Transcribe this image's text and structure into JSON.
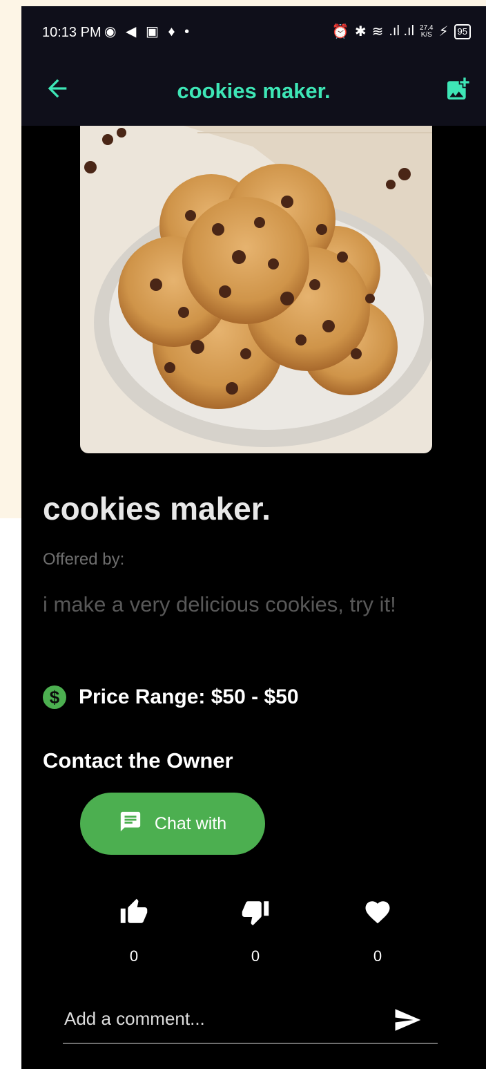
{
  "status_bar": {
    "time": "10:13 PM",
    "net_speed_value": "27.4",
    "net_speed_unit": "K/S",
    "battery": "95"
  },
  "app_bar": {
    "title": "cookies maker.",
    "back_icon": "arrow-left-icon",
    "action_icon": "add-photo-icon",
    "accent_color": "#3ee6b6"
  },
  "listing": {
    "title": "cookies maker.",
    "offered_by_label": "Offered by:",
    "description": "i make a very delicious cookies, try it!",
    "price_label": "Price Range: $50 - $50",
    "price_icon": "dollar-circle-icon",
    "price_icon_glyph": "$"
  },
  "contact": {
    "heading": "Contact the Owner",
    "chat_button_label": "Chat with",
    "chat_icon": "chat-icon",
    "button_color": "#4caf50"
  },
  "reactions": [
    {
      "icon": "thumb-up-icon",
      "count": "0"
    },
    {
      "icon": "thumb-down-icon",
      "count": "0"
    },
    {
      "icon": "heart-icon",
      "count": "0"
    }
  ],
  "comment": {
    "placeholder": "Add a comment...",
    "send_icon": "send-icon"
  }
}
